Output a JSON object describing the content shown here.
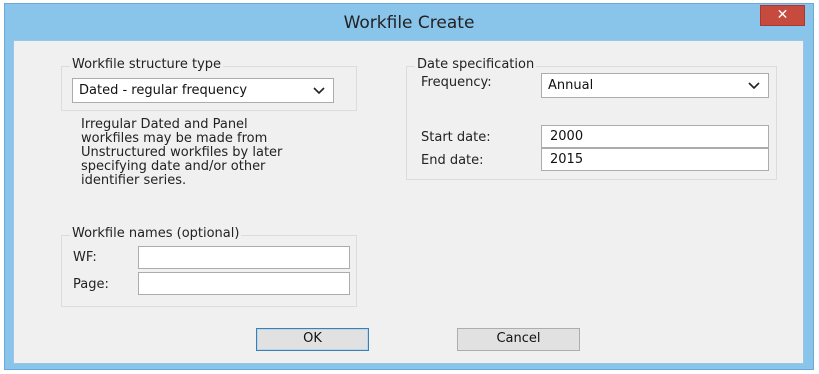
{
  "window": {
    "title": "Workfile Create",
    "close_glyph": "✕"
  },
  "structure": {
    "group_label": "Workfile structure type",
    "selected": "Dated - regular frequency",
    "note_lines": [
      "Irregular Dated and Panel",
      "workfiles may be made from",
      "Unstructured workfiles by later",
      "specifying date and/or other",
      "identifier series."
    ]
  },
  "date_spec": {
    "group_label": "Date specification",
    "frequency_label": "Frequency:",
    "frequency_value": "Annual",
    "start_label": "Start date:",
    "start_value": "2000",
    "end_label": "End date:",
    "end_value": "2015"
  },
  "names": {
    "group_label": "Workfile names (optional)",
    "wf_label": "WF:",
    "wf_value": "",
    "page_label": "Page:",
    "page_value": ""
  },
  "buttons": {
    "ok": "OK",
    "cancel": "Cancel"
  }
}
